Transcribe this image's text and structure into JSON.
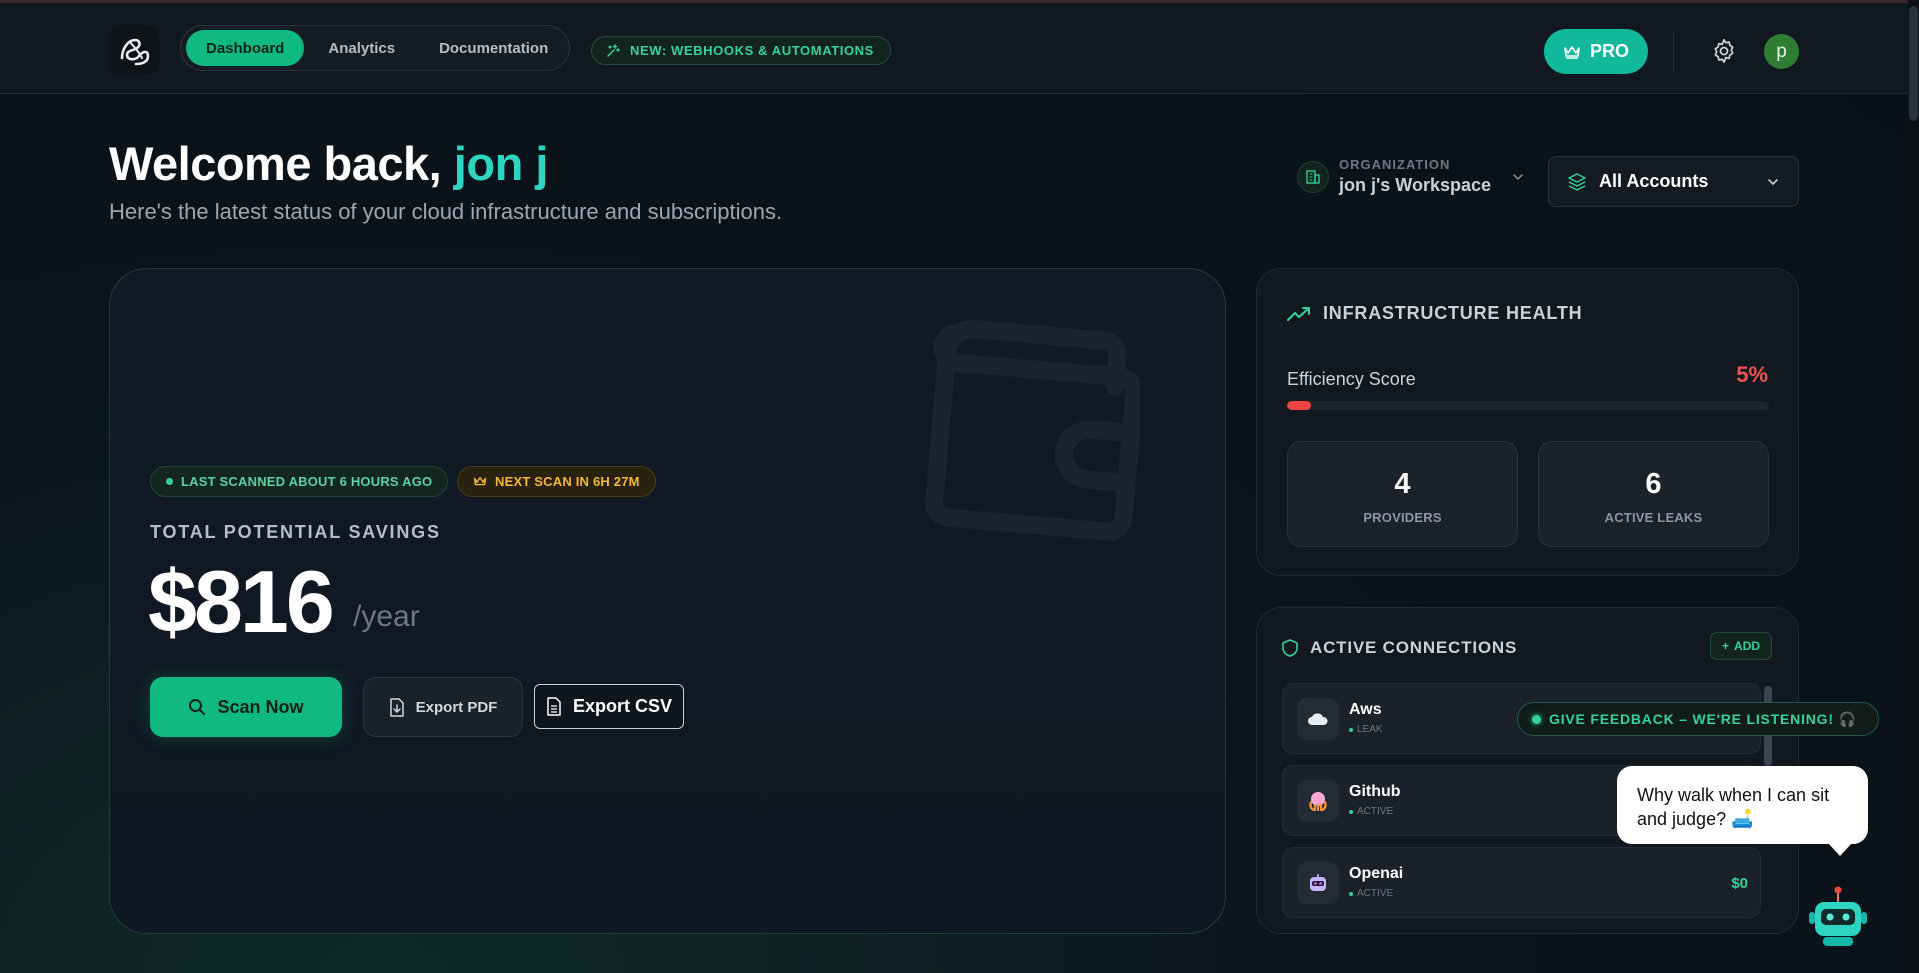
{
  "header": {
    "nav": [
      {
        "label": "Dashboard",
        "active": true
      },
      {
        "label": "Analytics",
        "active": false
      },
      {
        "label": "Documentation",
        "active": false
      }
    ],
    "new_badge": "NEW: WEBHOOKS & AUTOMATIONS",
    "pro_label": "PRO",
    "avatar_initial": "p"
  },
  "welcome": {
    "prefix": "Welcome back, ",
    "name": "jon j",
    "subtitle": "Here's the latest status of your cloud infrastructure and subscriptions."
  },
  "organization": {
    "label": "ORGANIZATION",
    "value": "jon j's Workspace"
  },
  "accounts_select": {
    "value": "All Accounts"
  },
  "savings": {
    "last_scanned": "LAST SCANNED ABOUT 6 HOURS AGO",
    "next_scan": "NEXT SCAN IN 6H 27M",
    "label": "TOTAL POTENTIAL SAVINGS",
    "amount": "$816",
    "period": "/year",
    "scan_button": "Scan Now",
    "export_pdf": "Export PDF",
    "export_csv": "Export CSV"
  },
  "health": {
    "title": "INFRASTRUCTURE HEALTH",
    "efficiency_label": "Efficiency Score",
    "efficiency_value": "5%",
    "efficiency_fraction": 0.05,
    "stats": [
      {
        "value": "4",
        "label": "PROVIDERS"
      },
      {
        "value": "6",
        "label": "ACTIVE LEAKS"
      }
    ]
  },
  "connections": {
    "title": "ACTIVE CONNECTIONS",
    "add_label": "ADD",
    "items": [
      {
        "name": "Aws",
        "status": "LEAK",
        "amount": "",
        "icon": "cloud-icon"
      },
      {
        "name": "Github",
        "status": "ACTIVE",
        "amount": "",
        "icon": "octocat-icon"
      },
      {
        "name": "Openai",
        "status": "ACTIVE",
        "amount": "$0",
        "icon": "robot-face-icon"
      }
    ]
  },
  "feedback": {
    "label": "GIVE FEEDBACK – WE'RE LISTENING! 🎧"
  },
  "mascot": {
    "bubble": "Why walk when I can sit and judge? 🛋️"
  },
  "colors": {
    "accent": "#10b981",
    "teal": "#2dd4bf",
    "danger": "#ef4444",
    "warning": "#f5b836",
    "background": "#0b141b"
  }
}
